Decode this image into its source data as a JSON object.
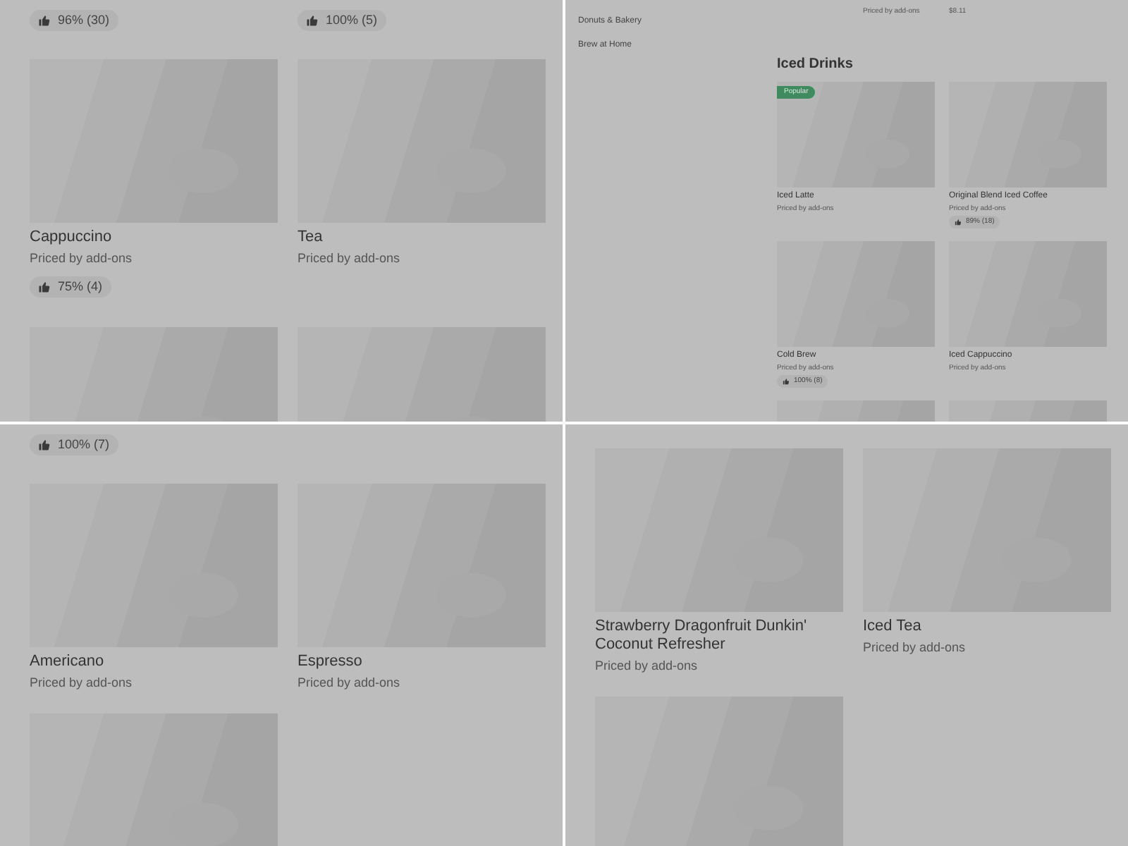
{
  "panels": [
    {
      "kind": "grid",
      "top_ratings": [
        "96% (30)",
        "100% (5)"
      ],
      "cards": [
        {
          "kind": "item",
          "name": "Cappuccino",
          "price": "Priced by add-ons",
          "rating": "75% (4)"
        },
        {
          "kind": "item",
          "name": "Tea",
          "price": "Priced by add-ons"
        },
        {
          "kind": "picture"
        },
        {
          "kind": "picture"
        }
      ]
    },
    {
      "kind": "menu",
      "sidebar": {
        "items": [
          "Donuts & Bakery",
          "Brew at Home"
        ]
      },
      "top_row": [
        {
          "price": "Priced by add-ons"
        },
        {
          "price": "$8.11"
        }
      ],
      "section_title": "Iced Drinks",
      "cards": [
        {
          "kind": "item",
          "name": "Iced Latte",
          "price": "Priced by add-ons",
          "badge": "Popular"
        },
        {
          "kind": "item",
          "name": "Original Blend Iced Coffee",
          "price": "Priced by add-ons",
          "rating": "89% (18)"
        },
        {
          "kind": "item",
          "name": "Cold Brew",
          "price": "Priced by add-ons",
          "rating": "100% (8)"
        },
        {
          "kind": "item",
          "name": "Iced Cappuccino",
          "price": "Priced by add-ons"
        },
        {
          "kind": "picture"
        },
        {
          "kind": "picture"
        }
      ]
    },
    {
      "kind": "grid",
      "top_ratings": [
        "100% (7)"
      ],
      "cards": [
        {
          "kind": "item",
          "name": "Americano",
          "price": "Priced by add-ons"
        },
        {
          "kind": "item",
          "name": "Espresso",
          "price": "Priced by add-ons"
        },
        {
          "kind": "picture"
        }
      ]
    },
    {
      "kind": "grid",
      "cards": [
        {
          "kind": "item",
          "name": "Strawberry Dragonfruit Dunkin' Coconut Refresher",
          "price": "Priced by add-ons"
        },
        {
          "kind": "item",
          "name": "Iced Tea",
          "price": "Priced by add-ons"
        },
        {
          "kind": "picture"
        }
      ]
    }
  ]
}
